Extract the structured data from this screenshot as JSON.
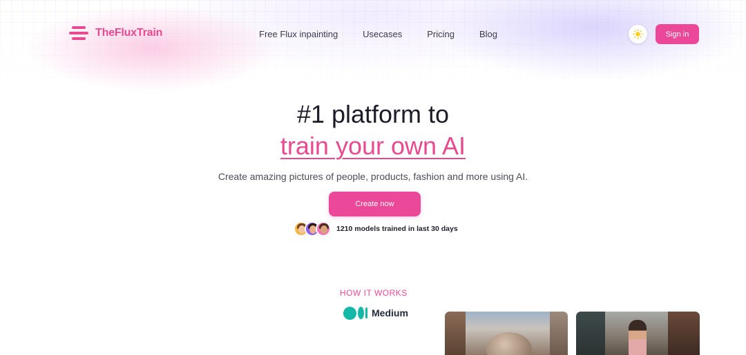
{
  "header": {
    "brand": "TheFluxTrain",
    "nav": [
      {
        "label": "Free Flux inpainting"
      },
      {
        "label": "Usecases"
      },
      {
        "label": "Pricing"
      },
      {
        "label": "Blog"
      }
    ],
    "theme_icon": "sun-icon",
    "signin_label": "Sign in"
  },
  "hero": {
    "title_line1": "#1 platform to",
    "title_line2": "train your own AI",
    "subtitle": "Create amazing pictures of people, products, fashion and more using AI.",
    "cta_label": "Create now",
    "proof_text": "1210 models trained in last 30 days"
  },
  "how_it_works": {
    "label": "HOW IT WORKS",
    "medium_label": "Medium"
  },
  "colors": {
    "accent": "#ec4899",
    "brand": "#e84a8f",
    "medium": "#14b8a6"
  }
}
